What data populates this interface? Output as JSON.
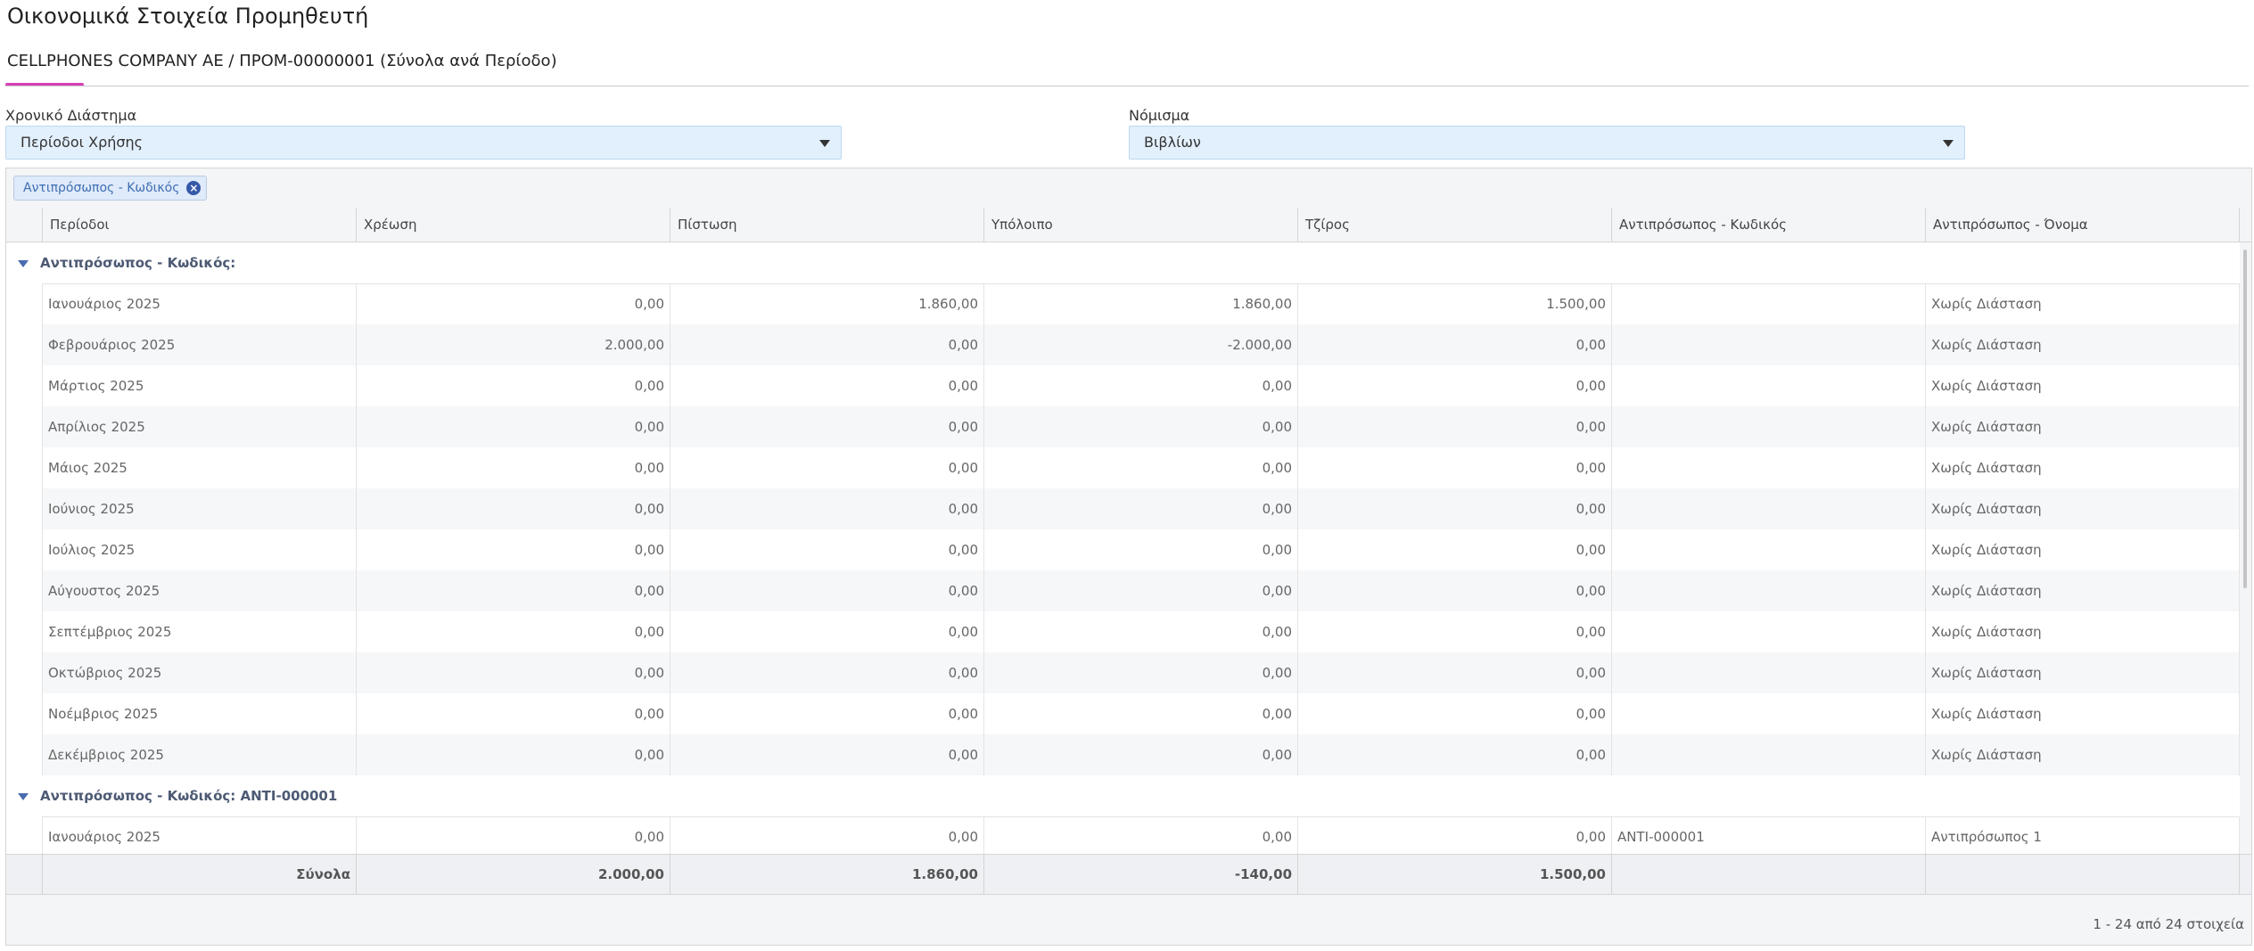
{
  "page": {
    "title": "Οικονομικά Στοιχεία Προμηθευτή",
    "subtitle": "CELLPHONES COMPANY AE / ΠΡΟΜ-00000001 (Σύνολα ανά Περίοδο)"
  },
  "filters": {
    "period_label": "Χρονικό Διάστημα",
    "period_value": "Περίοδοι Χρήσης",
    "currency_label": "Νόμισμα",
    "currency_value": "Βιβλίων"
  },
  "grouping": {
    "chip_label": "Αντιπρόσωπος - Κωδικός"
  },
  "columns": [
    "Περίοδοι",
    "Χρέωση",
    "Πίστωση",
    "Υπόλοιπο",
    "Τζίρος",
    "Αντιπρόσωπος - Κωδικός",
    "Αντιπρόσωπος - Όνομα"
  ],
  "groups": [
    {
      "label": "Αντιπρόσωπος - Κωδικός:",
      "rows": [
        [
          "Ιανουάριος 2025",
          "0,00",
          "1.860,00",
          "1.860,00",
          "1.500,00",
          "",
          "Χωρίς Διάσταση"
        ],
        [
          "Φεβρουάριος 2025",
          "2.000,00",
          "0,00",
          "-2.000,00",
          "0,00",
          "",
          "Χωρίς Διάσταση"
        ],
        [
          "Μάρτιος 2025",
          "0,00",
          "0,00",
          "0,00",
          "0,00",
          "",
          "Χωρίς Διάσταση"
        ],
        [
          "Απρίλιος 2025",
          "0,00",
          "0,00",
          "0,00",
          "0,00",
          "",
          "Χωρίς Διάσταση"
        ],
        [
          "Μάιος 2025",
          "0,00",
          "0,00",
          "0,00",
          "0,00",
          "",
          "Χωρίς Διάσταση"
        ],
        [
          "Ιούνιος 2025",
          "0,00",
          "0,00",
          "0,00",
          "0,00",
          "",
          "Χωρίς Διάσταση"
        ],
        [
          "Ιούλιος 2025",
          "0,00",
          "0,00",
          "0,00",
          "0,00",
          "",
          "Χωρίς Διάσταση"
        ],
        [
          "Αύγουστος 2025",
          "0,00",
          "0,00",
          "0,00",
          "0,00",
          "",
          "Χωρίς Διάσταση"
        ],
        [
          "Σεπτέμβριος 2025",
          "0,00",
          "0,00",
          "0,00",
          "0,00",
          "",
          "Χωρίς Διάσταση"
        ],
        [
          "Οκτώβριος 2025",
          "0,00",
          "0,00",
          "0,00",
          "0,00",
          "",
          "Χωρίς Διάσταση"
        ],
        [
          "Νοέμβριος 2025",
          "0,00",
          "0,00",
          "0,00",
          "0,00",
          "",
          "Χωρίς Διάσταση"
        ],
        [
          "Δεκέμβριος 2025",
          "0,00",
          "0,00",
          "0,00",
          "0,00",
          "",
          "Χωρίς Διάσταση"
        ]
      ]
    },
    {
      "label": "Αντιπρόσωπος - Κωδικός: ANTI-000001",
      "rows": [
        [
          "Ιανουάριος 2025",
          "0,00",
          "0,00",
          "0,00",
          "0,00",
          "ANTI-000001",
          "Αντιπρόσωπος 1"
        ]
      ]
    }
  ],
  "totals": {
    "label": "Σύνολα",
    "values": [
      "2.000,00",
      "1.860,00",
      "-140,00",
      "1.500,00",
      "",
      ""
    ]
  },
  "pager": {
    "text": "1 - 24 από 24 στοιχεία"
  },
  "colors": {
    "accent_tab": "#d63eb6",
    "select_bg": "#e2f0fd",
    "chip_text": "#3f6eb3",
    "chip_icon": "#3558a8"
  },
  "icons": {
    "dropdown": "caret-down-icon",
    "chip_remove": "close-circle-icon",
    "group_toggle": "caret-down-icon"
  }
}
